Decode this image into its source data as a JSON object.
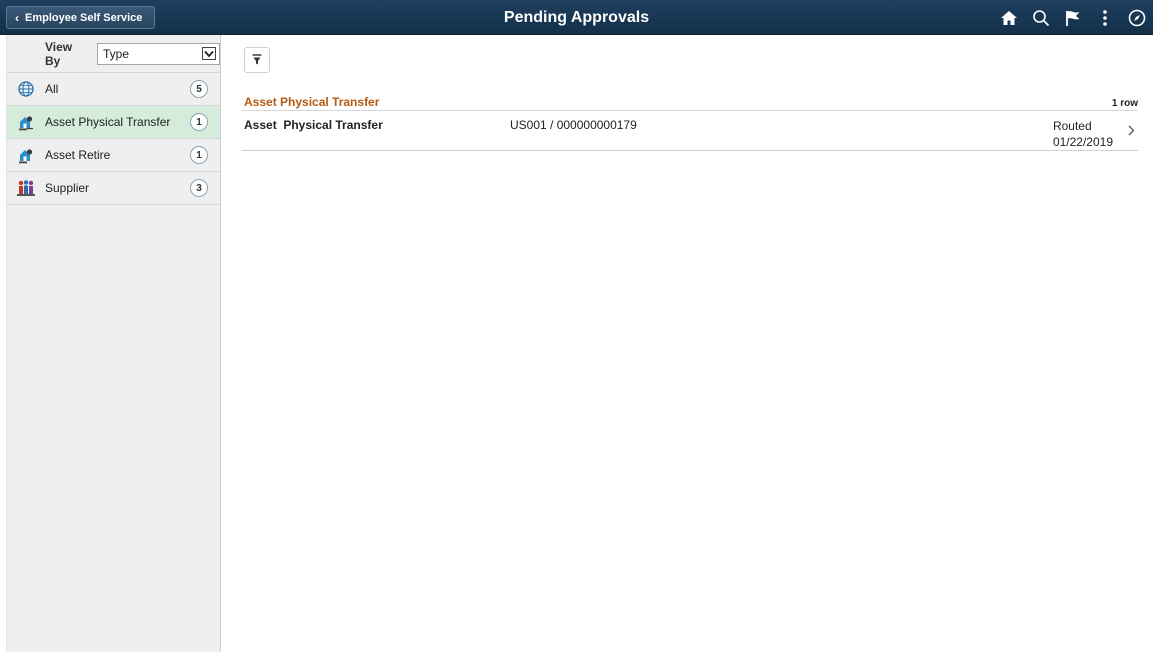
{
  "header": {
    "back_label": "Employee Self Service",
    "title": "Pending Approvals",
    "icons": [
      "home-icon",
      "search-icon",
      "flag-icon",
      "more-icon",
      "navigator-icon"
    ],
    "bg_color": "#1a3a57"
  },
  "sidebar": {
    "viewby_label": "View By",
    "viewby_value": "Type",
    "items": [
      {
        "label": "All",
        "count": "5",
        "icon": "globe-icon"
      },
      {
        "label": "Asset Physical Transfer",
        "count": "1",
        "icon": "asset-transfer-icon",
        "selected": true
      },
      {
        "label": "Asset Retire",
        "count": "1",
        "icon": "asset-retire-icon"
      },
      {
        "label": "Supplier",
        "count": "3",
        "icon": "supplier-icon"
      }
    ],
    "selected_color": "#d6ecdb"
  },
  "main": {
    "group_title": "Asset Physical Transfer",
    "row_count": "1 row",
    "rows": [
      {
        "name": "Asset  Physical Transfer",
        "id": "US001 / 000000000179",
        "status": "Routed",
        "date": "01/22/2019"
      }
    ],
    "accent_color": "#b35a13"
  }
}
